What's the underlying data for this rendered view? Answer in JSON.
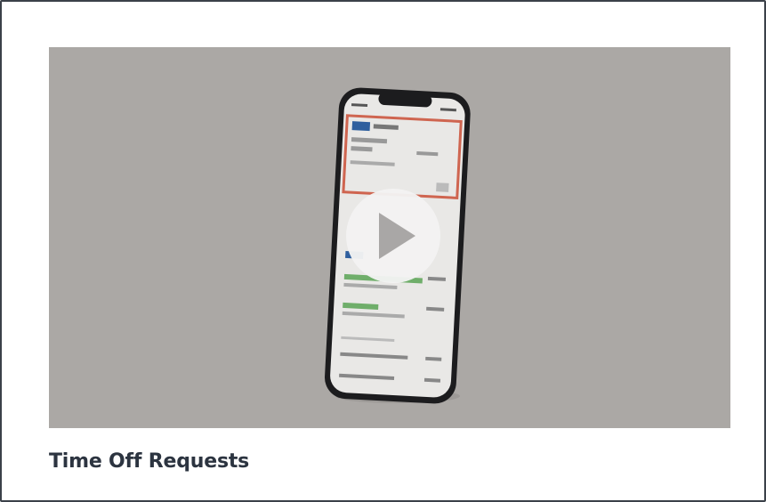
{
  "card": {
    "title": "Time Off Requests"
  },
  "video": {
    "state": "paused",
    "play_icon": "play-icon",
    "thumbnail_subject": "phone-app-screen"
  },
  "colors": {
    "card_border": "#3b4149",
    "video_background": "#aba8a5",
    "title_text": "#2c3440",
    "play_circle": "#f2f2f2",
    "play_triangle": "#a9a7a6",
    "phone_frame": "#1c1c1e",
    "accent_red": "#c8432b",
    "accent_blue": "#2f5f9e",
    "accent_green": "#6fae6a"
  }
}
